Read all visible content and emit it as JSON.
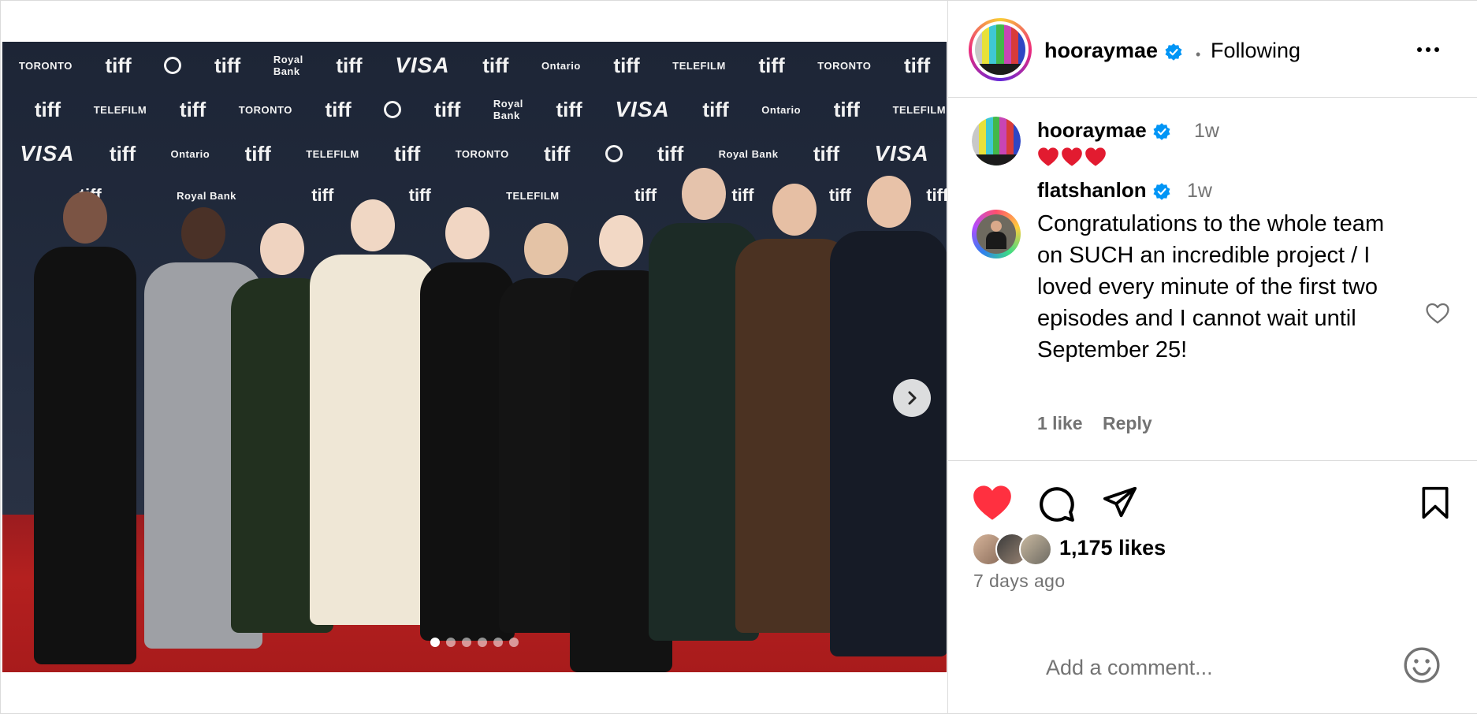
{
  "post": {
    "author": "hooraymae",
    "follow_separator": "•",
    "follow_state": "Following",
    "media": {
      "backdrop_brands": [
        "tiff",
        "TORONTO",
        "Royal Bank",
        "VISA",
        "Ontario",
        "TELEFILM CANADA"
      ],
      "carousel_count": 6,
      "carousel_active_index": 0
    }
  },
  "caption": {
    "author": "hooraymae",
    "time": "1w",
    "text": "❤️❤️❤️"
  },
  "comment": {
    "author": "flatshanlon",
    "time": "1w",
    "text": "Congratulations to the whole team on SUCH an incredible project / I loved every minute of the first two episodes and I cannot wait until September 25!",
    "likes": "1 like",
    "reply_label": "Reply"
  },
  "stats": {
    "likes": "1,175 likes",
    "time_ago": "7 days ago"
  },
  "composer": {
    "placeholder": "Add a comment..."
  },
  "colors": {
    "verified": "#0095f6",
    "like_active": "#ff3040",
    "muted_text": "#737373",
    "divider": "#dbdbdb"
  },
  "icons": [
    "verified-badge-icon",
    "more-options-icon",
    "heart-icon",
    "comment-icon",
    "share-icon",
    "bookmark-icon",
    "chevron-right-icon",
    "emoji-icon"
  ]
}
